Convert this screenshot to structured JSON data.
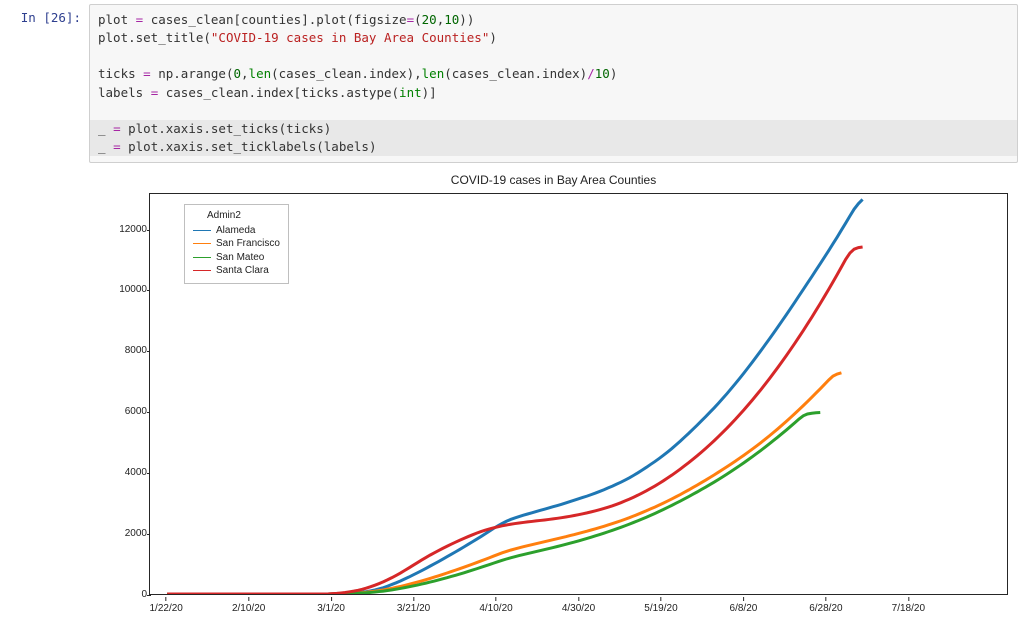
{
  "cell": {
    "prompt": "In [26]:",
    "code": {
      "l1a": "plot ",
      "l1op": "=",
      "l1b": " cases_clean[counties].plot(figsize",
      "l1op2": "=",
      "l1c": "(",
      "l1n1": "20",
      "l1comma": ",",
      "l1n2": "10",
      "l1d": "))",
      "l2a": "plot.set_title(",
      "l2str": "\"COVID-19 cases in Bay Area Counties\"",
      "l2b": ")",
      "l3a": "ticks ",
      "l3op": "=",
      "l3b": " np.arange(",
      "l3n1": "0",
      "l3c": ",",
      "l3len1": "len",
      "l3d": "(cases_clean.index),",
      "l3len2": "len",
      "l3e": "(cases_clean.index)",
      "l3op2": "/",
      "l3n2": "10",
      "l3f": ")",
      "l4a": "labels ",
      "l4op": "=",
      "l4b": " cases_clean.index[ticks.astype(",
      "l4int": "int",
      "l4c": ")]",
      "l5a": "_ ",
      "l5op": "=",
      "l5b": " plot.xaxis.set_ticks(ticks)",
      "l6a": "_ ",
      "l6op": "=",
      "l6b": " plot.xaxis.set_ticklabels(labels)"
    }
  },
  "chart_data": {
    "type": "line",
    "title": "COVID-19 cases in Bay Area Counties",
    "legend_title": "Admin2",
    "xlabel": "",
    "ylabel": "",
    "ylim": [
      0,
      13200
    ],
    "y_ticks": [
      0,
      2000,
      4000,
      6000,
      8000,
      10000,
      12000
    ],
    "x_categories": [
      "1/22/20",
      "2/10/20",
      "3/1/20",
      "3/21/20",
      "4/10/20",
      "4/30/20",
      "5/19/20",
      "6/8/20",
      "6/28/20",
      "7/18/20"
    ],
    "x_n_points": 195,
    "colors": {
      "Alameda": "#1f77b4",
      "San Francisco": "#ff7f0e",
      "San Mateo": "#2ca02c",
      "Santa Clara": "#d62728"
    },
    "series": [
      {
        "name": "Alameda",
        "values": [
          0,
          0,
          0,
          0,
          0,
          0,
          0,
          0,
          0,
          0,
          0,
          0,
          0,
          0,
          0,
          0,
          0,
          0,
          0,
          0,
          0,
          0,
          0,
          0,
          0,
          0,
          0,
          0,
          0,
          0,
          0,
          0,
          0,
          0,
          0,
          0,
          0,
          0,
          0,
          5,
          10,
          15,
          20,
          28,
          36,
          45,
          60,
          80,
          105,
          135,
          170,
          210,
          260,
          315,
          370,
          430,
          495,
          560,
          630,
          700,
          770,
          845,
          920,
          995,
          1070,
          1150,
          1230,
          1310,
          1390,
          1470,
          1555,
          1640,
          1725,
          1810,
          1895,
          1985,
          2075,
          2165,
          2250,
          2330,
          2400,
          2460,
          2510,
          2555,
          2600,
          2640,
          2680,
          2720,
          2760,
          2800,
          2840,
          2880,
          2920,
          2960,
          3005,
          3050,
          3095,
          3140,
          3185,
          3230,
          3280,
          3330,
          3385,
          3440,
          3500,
          3560,
          3625,
          3690,
          3760,
          3835,
          3915,
          4000,
          4090,
          4180,
          4275,
          4370,
          4470,
          4575,
          4685,
          4800,
          4920,
          5045,
          5175,
          5305,
          5440,
          5575,
          5715,
          5855,
          6000,
          6145,
          6295,
          6450,
          6610,
          6775,
          6945,
          7115,
          7290,
          7470,
          7655,
          7840,
          8030,
          8220,
          8415,
          8610,
          8810,
          9010,
          9215,
          9420,
          9630,
          9840,
          10050,
          10260,
          10470,
          10685,
          10900,
          11115,
          11335,
          11555,
          11780,
          12010,
          12240,
          12475,
          12700,
          12880,
          13020
        ]
      },
      {
        "name": "San Francisco",
        "values": [
          0,
          0,
          0,
          0,
          0,
          0,
          0,
          0,
          0,
          0,
          0,
          0,
          0,
          0,
          0,
          0,
          0,
          0,
          0,
          0,
          0,
          0,
          0,
          0,
          0,
          0,
          0,
          0,
          0,
          0,
          0,
          0,
          0,
          0,
          0,
          0,
          0,
          0,
          0,
          2,
          5,
          8,
          12,
          18,
          25,
          34,
          45,
          58,
          74,
          92,
          112,
          135,
          160,
          188,
          218,
          250,
          283,
          318,
          355,
          393,
          432,
          473,
          515,
          558,
          602,
          647,
          693,
          740,
          788,
          836,
          885,
          935,
          986,
          1038,
          1090,
          1143,
          1197,
          1251,
          1305,
          1358,
          1405,
          1448,
          1488,
          1525,
          1560,
          1594,
          1627,
          1660,
          1693,
          1726,
          1759,
          1792,
          1825,
          1858,
          1892,
          1927,
          1962,
          1998,
          2035,
          2073,
          2112,
          2152,
          2193,
          2235,
          2278,
          2323,
          2369,
          2417,
          2467,
          2519,
          2573,
          2629,
          2687,
          2746,
          2807,
          2869,
          2933,
          2999,
          3067,
          3137,
          3209,
          3283,
          3359,
          3436,
          3515,
          3595,
          3677,
          3760,
          3845,
          3931,
          4019,
          4108,
          4199,
          4291,
          4385,
          4481,
          4579,
          4679,
          4782,
          4887,
          4995,
          5105,
          5218,
          5334,
          5452,
          5573,
          5697,
          5823,
          5952,
          6083,
          6216,
          6352,
          6490,
          6630,
          6772,
          6916,
          7062,
          7190,
          7260,
          7300
        ]
      },
      {
        "name": "San Mateo",
        "values": [
          0,
          0,
          0,
          0,
          0,
          0,
          0,
          0,
          0,
          0,
          0,
          0,
          0,
          0,
          0,
          0,
          0,
          0,
          0,
          0,
          0,
          0,
          0,
          0,
          0,
          0,
          0,
          0,
          0,
          0,
          0,
          0,
          0,
          0,
          0,
          0,
          0,
          0,
          0,
          2,
          4,
          6,
          9,
          13,
          18,
          24,
          32,
          41,
          52,
          65,
          80,
          97,
          116,
          137,
          160,
          184,
          210,
          237,
          266,
          296,
          327,
          359,
          393,
          428,
          464,
          501,
          539,
          578,
          618,
          659,
          701,
          744,
          788,
          833,
          879,
          925,
          972,
          1019,
          1066,
          1112,
          1155,
          1195,
          1232,
          1267,
          1301,
          1334,
          1367,
          1400,
          1433,
          1466,
          1500,
          1534,
          1568,
          1603,
          1639,
          1676,
          1714,
          1753,
          1793,
          1834,
          1876,
          1919,
          1963,
          2008,
          2054,
          2101,
          2150,
          2200,
          2252,
          2306,
          2361,
          2418,
          2476,
          2535,
          2596,
          2658,
          2722,
          2788,
          2856,
          2925,
          2996,
          3068,
          3142,
          3217,
          3293,
          3370,
          3449,
          3529,
          3611,
          3694,
          3779,
          3866,
          3955,
          4046,
          4139,
          4234,
          4331,
          4430,
          4531,
          4634,
          4739,
          4846,
          4955,
          5066,
          5179,
          5294,
          5411,
          5530,
          5651,
          5774,
          5880,
          5940,
          5965,
          5980,
          5990
        ]
      },
      {
        "name": "Santa Clara",
        "values": [
          0,
          0,
          0,
          0,
          0,
          0,
          0,
          0,
          0,
          0,
          0,
          0,
          0,
          0,
          0,
          0,
          0,
          0,
          0,
          0,
          0,
          0,
          0,
          0,
          0,
          0,
          0,
          0,
          0,
          0,
          0,
          0,
          0,
          0,
          0,
          0,
          0,
          0,
          3,
          10,
          20,
          34,
          52,
          72,
          95,
          122,
          155,
          195,
          240,
          290,
          345,
          405,
          470,
          540,
          614,
          692,
          775,
          860,
          947,
          1034,
          1120,
          1203,
          1283,
          1360,
          1434,
          1506,
          1576,
          1644,
          1710,
          1774,
          1836,
          1896,
          1954,
          2009,
          2060,
          2106,
          2147,
          2184,
          2218,
          2249,
          2277,
          2302,
          2324,
          2344,
          2362,
          2379,
          2395,
          2411,
          2427,
          2443,
          2460,
          2478,
          2497,
          2518,
          2540,
          2564,
          2590,
          2617,
          2646,
          2677,
          2710,
          2745,
          2782,
          2822,
          2865,
          2911,
          2961,
          3014,
          3071,
          3131,
          3195,
          3262,
          3332,
          3406,
          3483,
          3563,
          3647,
          3735,
          3827,
          3922,
          4021,
          4123,
          4229,
          4338,
          4450,
          4565,
          4684,
          4806,
          4932,
          5061,
          5194,
          5331,
          5472,
          5617,
          5766,
          5919,
          6076,
          6237,
          6402,
          6571,
          6744,
          6921,
          7102,
          7287,
          7476,
          7669,
          7866,
          8067,
          8272,
          8481,
          8694,
          8911,
          9132,
          9357,
          9586,
          9819,
          10056,
          10297,
          10542,
          10791,
          11044,
          11250,
          11380,
          11430,
          11450
        ]
      }
    ]
  }
}
